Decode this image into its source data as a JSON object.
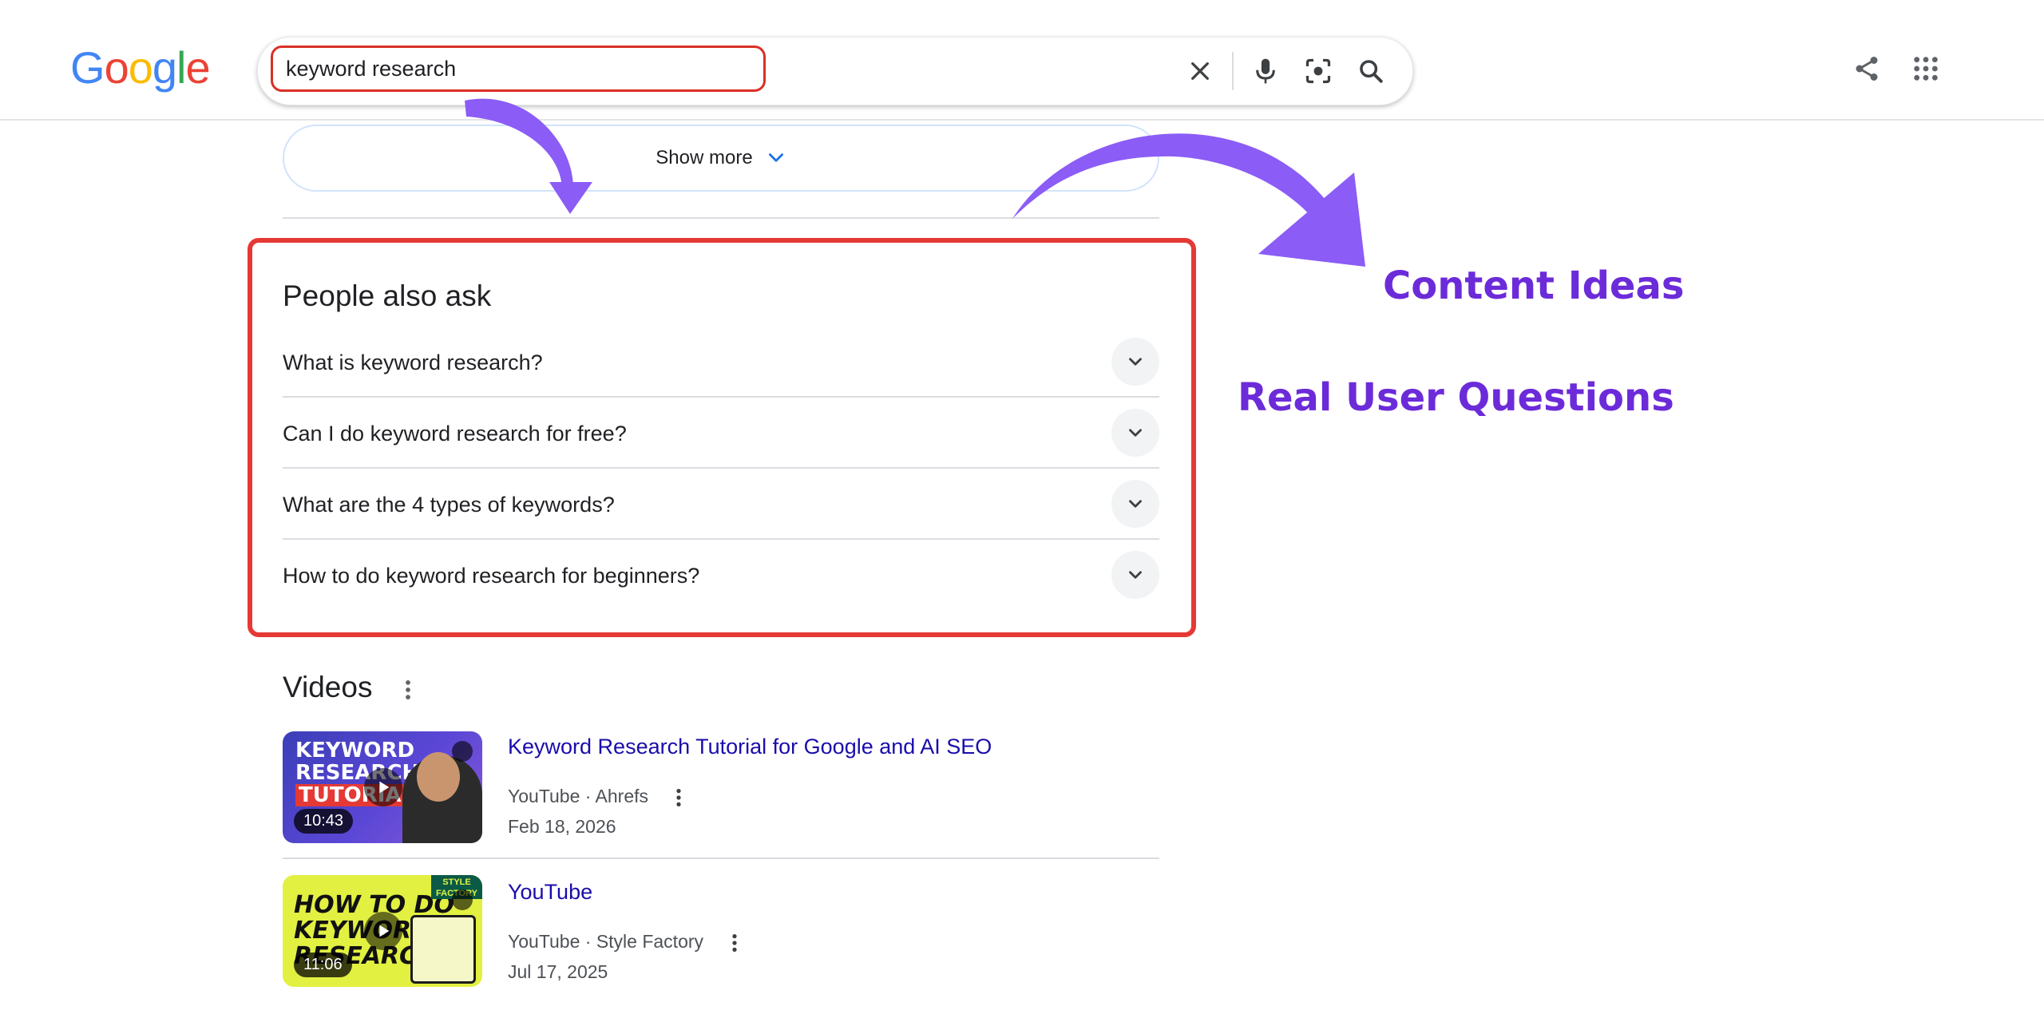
{
  "header": {
    "logo_letters": [
      "G",
      "o",
      "o",
      "g",
      "l",
      "e"
    ],
    "logo_colors": [
      "#4285f4",
      "#ea4335",
      "#fbbc05",
      "#4285f4",
      "#34a853",
      "#ea4335"
    ],
    "search_value": "keyword research",
    "icons": [
      "close-icon",
      "microphone-icon",
      "lens-icon",
      "search-icon",
      "share-icon",
      "apps-grid-icon"
    ]
  },
  "show_more": {
    "label": "Show more"
  },
  "people_also_ask": {
    "title": "People also ask",
    "questions": [
      "What is keyword research?",
      "Can I do keyword research for free?",
      "What are the 4 types of keywords?",
      "How to do keyword research for beginners?"
    ],
    "highlight_color": "#e53935"
  },
  "videos": {
    "title": "Videos",
    "items": [
      {
        "title": "Keyword Research Tutorial for Google and AI SEO",
        "source": "YouTube · Ahrefs",
        "date": "Feb 18, 2026",
        "duration": "10:43",
        "thumb_text": [
          "KEYWORD",
          "RESEARCH",
          "TUTORIAL"
        ]
      },
      {
        "title": "YouTube",
        "source": "YouTube · Style Factory",
        "date": "Jul 17, 2025",
        "duration": "11:06",
        "thumb_text": [
          "HOW TO DO",
          "KEYWORD",
          "RESEARCH"
        ],
        "badge": "STYLE FACTORY"
      }
    ]
  },
  "annotations": {
    "content_ideas": "Content Ideas",
    "real_user_questions": "Real User Questions",
    "color": "#6c2bd9"
  }
}
